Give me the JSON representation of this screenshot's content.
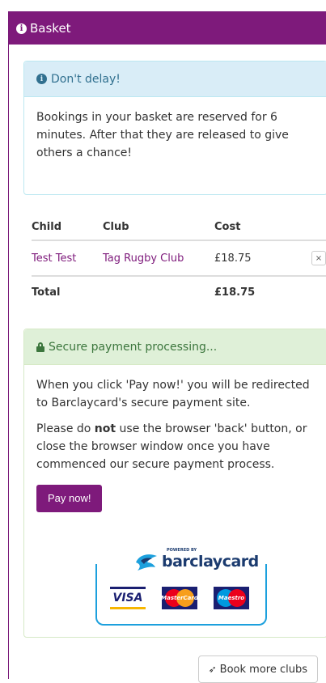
{
  "basket": {
    "title": "Basket"
  },
  "info_alert": {
    "heading": "Don't delay!",
    "body": "Bookings in your basket are reserved for 6 minutes. After that they are released to give others a chance!"
  },
  "table": {
    "headers": [
      "Child",
      "Club",
      "Cost"
    ],
    "rows": [
      {
        "child": "Test Test",
        "club": "Tag Rugby Club",
        "cost": "£18.75",
        "remove_label": "×"
      }
    ],
    "total_label": "Total",
    "total_value": "£18.75"
  },
  "payment": {
    "heading": "Secure payment processing...",
    "para1": "When you click 'Pay now!' you will be redirected to Barclaycard's secure payment site.",
    "para2_pre": "Please do ",
    "para2_bold": "not",
    "para2_post": " use the browser 'back' button, or close the browser window once you have commenced our secure payment process.",
    "pay_label": "Pay now!",
    "powered_by": "POWERED BY",
    "provider": "barclaycard",
    "cards": [
      "VISA",
      "MasterCard",
      "Maestro"
    ]
  },
  "book_more_label": "Book more clubs",
  "colors": {
    "brand": "#7e1a7b",
    "info": "#d9edf7",
    "success": "#dff0d8",
    "barclay_blue": "#1ca0dd"
  }
}
